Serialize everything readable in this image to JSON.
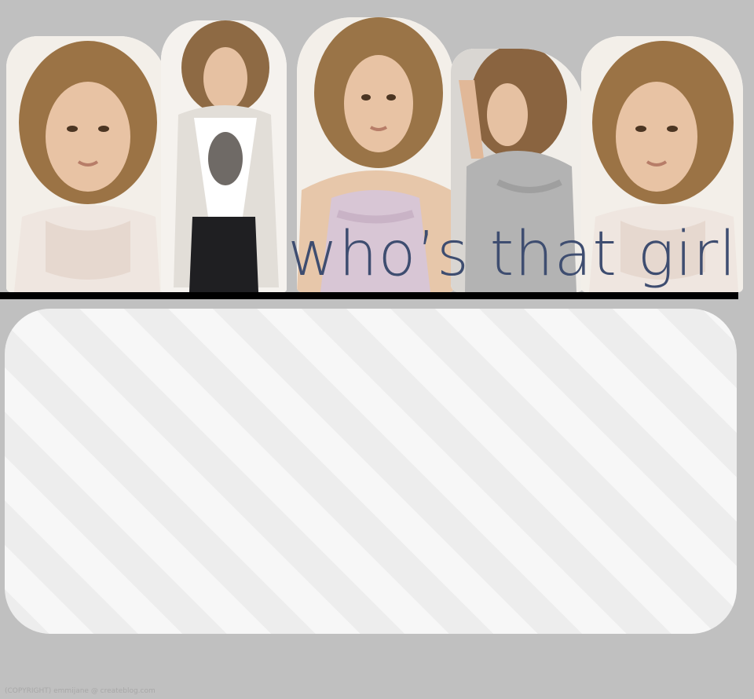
{
  "theme": {
    "background_color": "#c0c0c0",
    "title_color": "#3e4d70",
    "rule_color": "#000000",
    "panel_stripe_light": "#f7f7f7",
    "panel_stripe_dark": "#ededed"
  },
  "header": {
    "title": "who’s that girl",
    "photos": [
      {
        "name": "photo-1",
        "subject": "portrait with lace top"
      },
      {
        "name": "photo-2",
        "subject": "standing with cardigan and necklace"
      },
      {
        "name": "photo-3",
        "subject": "portrait with ruffled top"
      },
      {
        "name": "photo-4",
        "subject": "leaning with grey top"
      },
      {
        "name": "photo-5",
        "subject": "portrait with lace top"
      }
    ]
  },
  "footer": {
    "copyright": "(COPYRIGHT) emmijane @ createblog.com"
  }
}
